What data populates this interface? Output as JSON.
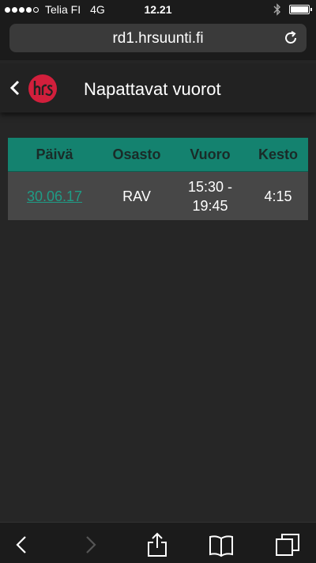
{
  "status": {
    "carrier": "Telia FI",
    "network": "4G",
    "time": "12.21",
    "signal_bars_filled": 4,
    "signal_bars_total": 5
  },
  "browser": {
    "url": "rd1.hrsuunti.fi"
  },
  "header": {
    "title": "Napattavat vuorot",
    "logo_text": "hrs"
  },
  "table": {
    "columns": [
      "Päivä",
      "Osasto",
      "Vuoro",
      "Kesto"
    ],
    "rows": [
      {
        "date": "30.06.17",
        "department": "RAV",
        "shift_start": "15:30 -",
        "shift_end": "19:45",
        "duration": "4:15"
      }
    ]
  },
  "colors": {
    "accent": "#14826f",
    "link": "#1f9c86",
    "brand": "#d21f3c",
    "background": "#262626"
  },
  "icons": {
    "back": "chevron-left-icon",
    "reload": "reload-icon",
    "browser_back": "browser-back-icon",
    "browser_forward": "browser-forward-icon",
    "share": "share-icon",
    "bookmarks": "bookmarks-icon",
    "tabs": "tabs-icon"
  }
}
